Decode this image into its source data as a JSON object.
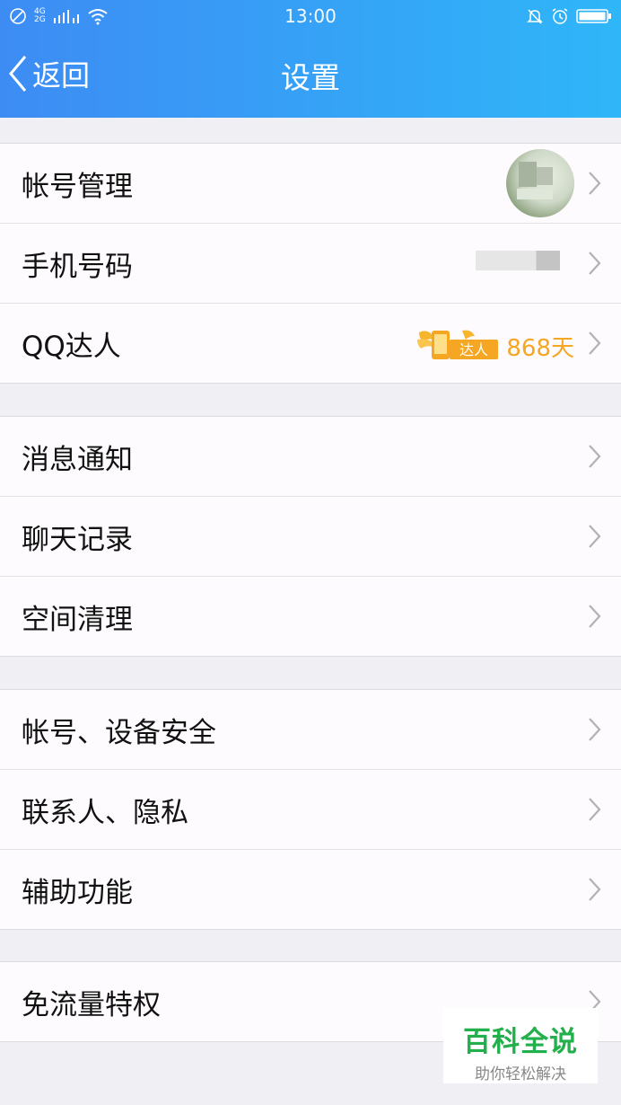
{
  "status_bar": {
    "time": "13:00",
    "network_top": "4G",
    "network_bottom": "2G"
  },
  "header": {
    "back_label": "返回",
    "title": "设置"
  },
  "groups": [
    {
      "items": [
        {
          "label": "帐号管理"
        },
        {
          "label": "手机号码"
        },
        {
          "label": "QQ达人",
          "badge_text": "达人",
          "days": "868天"
        }
      ]
    },
    {
      "items": [
        {
          "label": "消息通知"
        },
        {
          "label": "聊天记录"
        },
        {
          "label": "空间清理"
        }
      ]
    },
    {
      "items": [
        {
          "label": "帐号、设备安全"
        },
        {
          "label": "联系人、隐私"
        },
        {
          "label": "辅助功能"
        }
      ]
    },
    {
      "items": [
        {
          "label": "免流量特权"
        }
      ]
    }
  ],
  "watermark": {
    "title": "百科全说",
    "subtitle": "助你轻松解决"
  },
  "colors": {
    "header_start": "#3d8cf4",
    "header_end": "#2fb6f8",
    "daren_orange": "#f5a623",
    "watermark_green": "#21b04b"
  }
}
